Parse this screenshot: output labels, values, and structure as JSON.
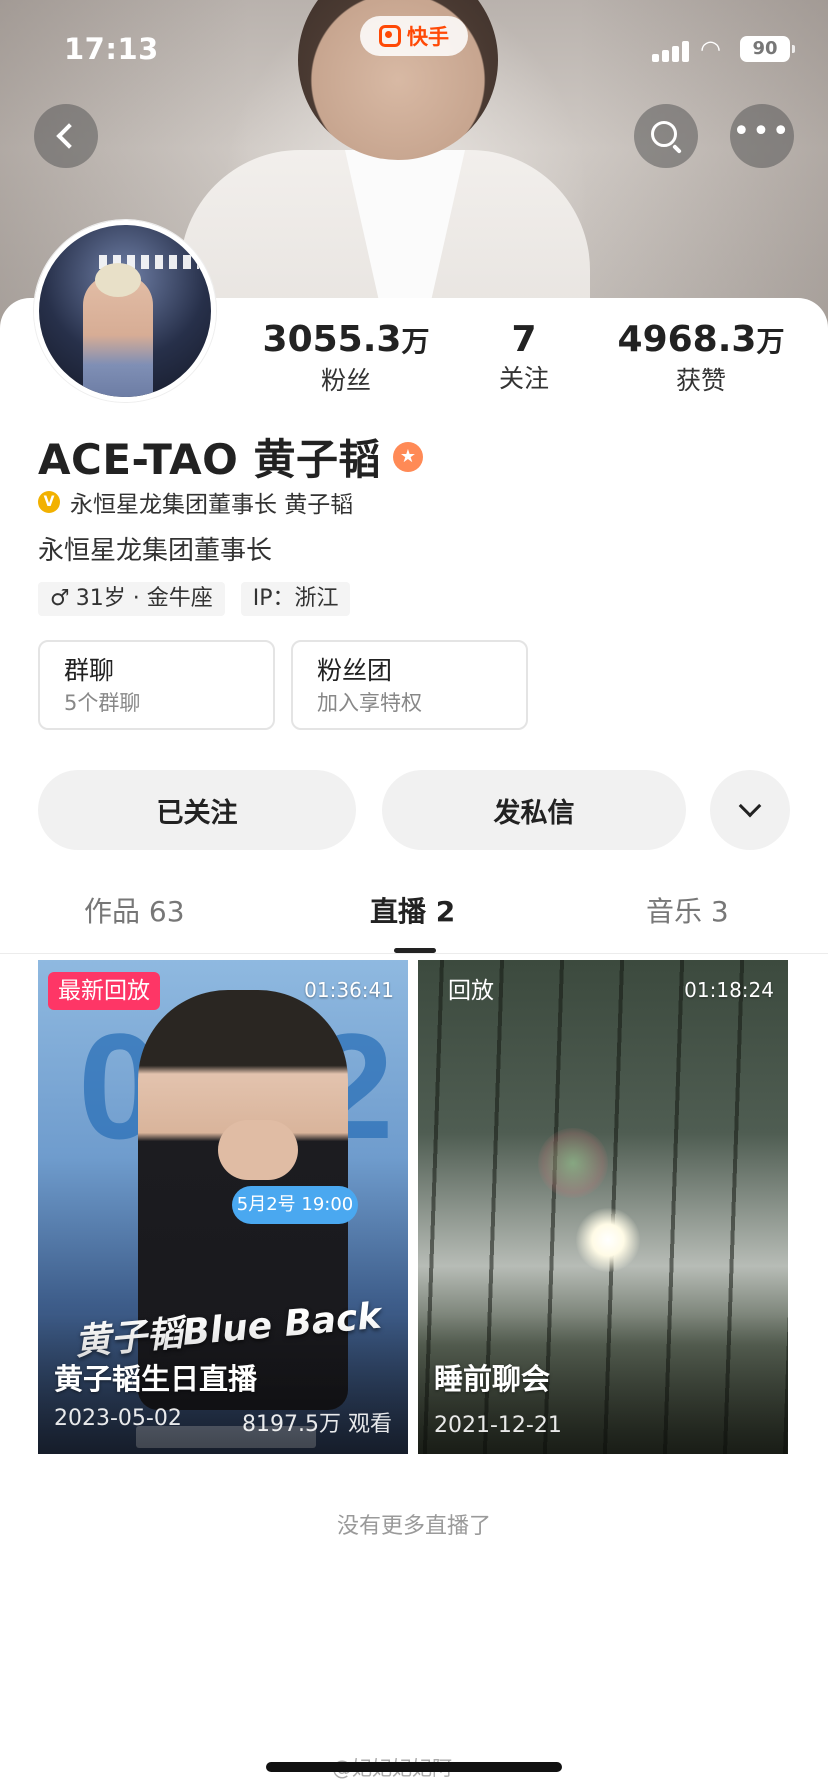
{
  "status_bar": {
    "time": "17:13",
    "app_name": "快手",
    "battery": "90",
    "wifi_glyph": "◠"
  },
  "nav": {
    "back_icon": "chevron-left-icon",
    "search_icon": "search-icon",
    "more_icon": "more-dots-icon",
    "more_glyph": "•••"
  },
  "profile": {
    "stats": {
      "followers": {
        "value": "3055.3",
        "unit": "万",
        "label": "粉丝"
      },
      "following": {
        "value": "7",
        "unit": "",
        "label": "关注"
      },
      "likes": {
        "value": "4968.3",
        "unit": "万",
        "label": "获赞"
      }
    },
    "name": "ACE-TAO 黄子韬",
    "name_badge_glyph": "★",
    "verify_badge_glyph": "V",
    "verification": "永恒星龙集团董事长 黄子韬",
    "bio": "永恒星龙集团董事长",
    "tags": {
      "gender_glyph": "♂",
      "age_sign": "31岁 · 金牛座",
      "ip": "IP：浙江"
    },
    "cards": [
      {
        "title": "群聊",
        "subtitle": "5个群聊"
      },
      {
        "title": "粉丝团",
        "subtitle": "加入享特权"
      }
    ],
    "actions": {
      "followed": "已关注",
      "message": "发私信"
    }
  },
  "tabs": [
    {
      "label": "作品 63"
    },
    {
      "label": "直播 2"
    },
    {
      "label": "音乐 3"
    }
  ],
  "live_replays": [
    {
      "badge": "最新回放",
      "duration": "01:36:41",
      "title": "黄子韬生日直播",
      "date": "2023-05-02",
      "views": "8197.5万 观看",
      "poster_number": "0502",
      "poster_bubble": "5月2号 19:00",
      "poster_promo": "黄子韬Blue Back"
    },
    {
      "badge": "回放",
      "duration": "01:18:24",
      "title": "睡前聊会",
      "date": "2021-12-21"
    }
  ],
  "no_more": "没有更多直播了",
  "watermark": "@妃妃妃妃阿"
}
